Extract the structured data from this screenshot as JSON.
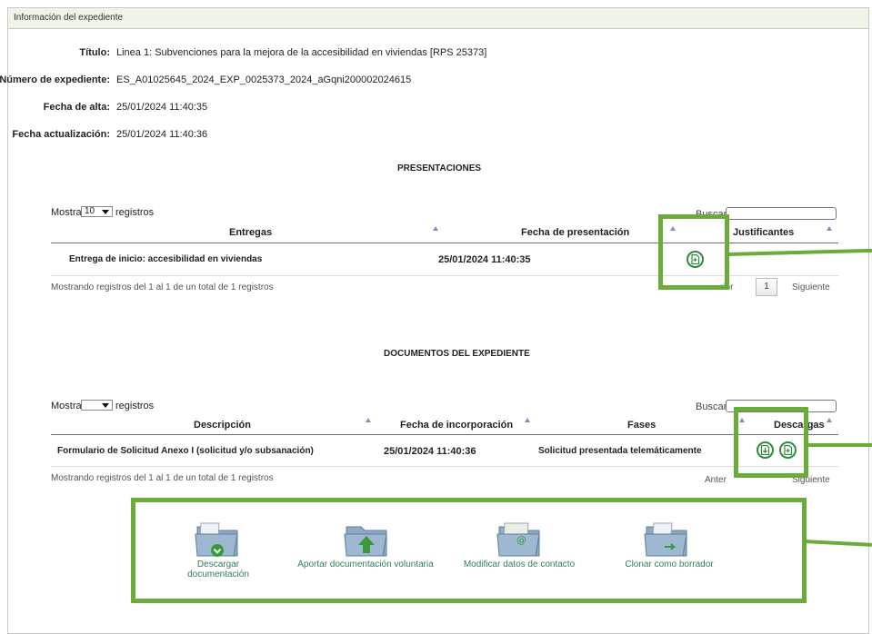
{
  "panel_title": "Información del expediente",
  "info": {
    "titulo_label": "Título:",
    "titulo_value": "Linea 1: Subvenciones para la mejora de la accesibilidad en viviendas [RPS 25373]",
    "numero_label": "Número de expediente:",
    "numero_value": "ES_A01025645_2024_EXP_0025373_2024_aGqni200002024615",
    "alta_label": "Fecha de alta:",
    "alta_value": "25/01/2024 11:40:35",
    "actualizacion_label": "Fecha actualización:",
    "actualizacion_value": "25/01/2024 11:40:36"
  },
  "presentaciones": {
    "title": "PRESENTACIONES",
    "show_prefix": "Mostrar",
    "show_value": "10",
    "show_suffix": "registros",
    "search_label": "Buscar:",
    "columns": [
      "Entregas",
      "Fecha de presentación",
      "Justificantes"
    ],
    "row": {
      "entrega": "Entrega de inicio: accesibilidad en viviendas",
      "fecha": "25/01/2024 11:40:35"
    },
    "info_text": "Mostrando registros del 1 al 1 de un total de 1 registros",
    "prev_label": "rior",
    "page": "1",
    "next_label": "Siguiente"
  },
  "documentos": {
    "title": "DOCUMENTOS DEL EXPEDIENTE",
    "show_prefix": "Mostrar",
    "show_value": "",
    "show_suffix": "registros",
    "search_label": "Buscar:",
    "columns": [
      "Descripción",
      "Fecha de incorporación",
      "Fases",
      "Descargas"
    ],
    "row": {
      "descripcion": "Formulario de Solicitud Anexo I (solicitud y/o subsanación)",
      "fecha": "25/01/2024 11:40:36",
      "fase": "Solicitud presentada telemáticamente"
    },
    "info_text": "Mostrando registros del 1 al 1 de un total de 1 registros",
    "prev_label": "Anter",
    "next_label": "Siguiente"
  },
  "actions": [
    {
      "label": "Descargar documentación",
      "icon": "folder-download-icon"
    },
    {
      "label": "Aportar documentación voluntaria",
      "icon": "folder-upload-icon"
    },
    {
      "label": "Modificar datos de contacto",
      "icon": "folder-email-icon"
    },
    {
      "label": "Clonar como borrador",
      "icon": "folder-clone-icon"
    }
  ],
  "colors": {
    "highlight": "#6aab3a",
    "icon_green": "#2e8b3c",
    "action_text": "#2e7d5b",
    "header_bg": "#eef4e8"
  }
}
